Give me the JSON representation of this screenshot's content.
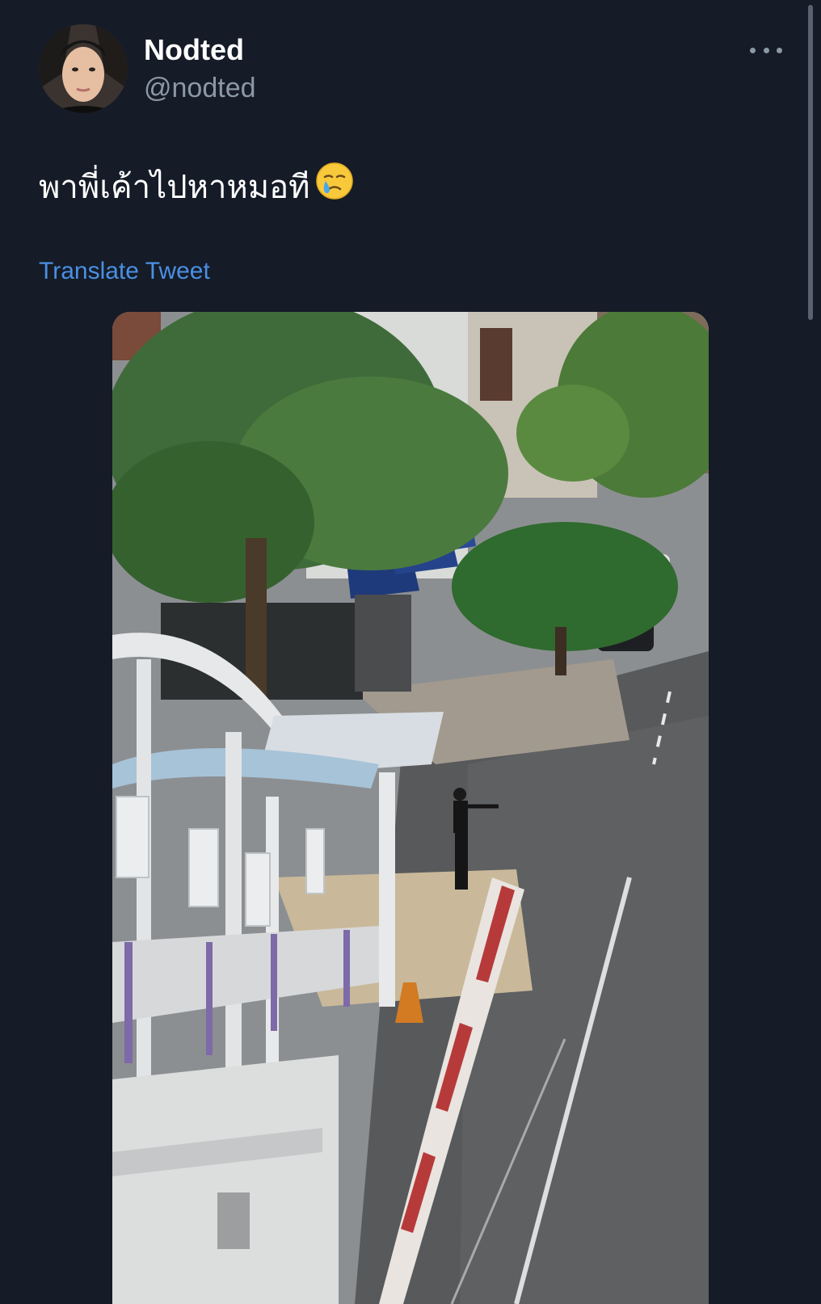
{
  "tweet": {
    "display_name": "Nodted",
    "handle": "@nodted",
    "text": "พาพี่เค้าไปหาหมอที",
    "emoji_icon": "crying-face-emoji",
    "translate_label": "Translate Tweet"
  },
  "header": {
    "more_icon": "more-options-icon"
  },
  "colors": {
    "background": "#151b27",
    "name": "#ffffff",
    "handle": "#8b98a5",
    "link": "#4a90e2"
  }
}
